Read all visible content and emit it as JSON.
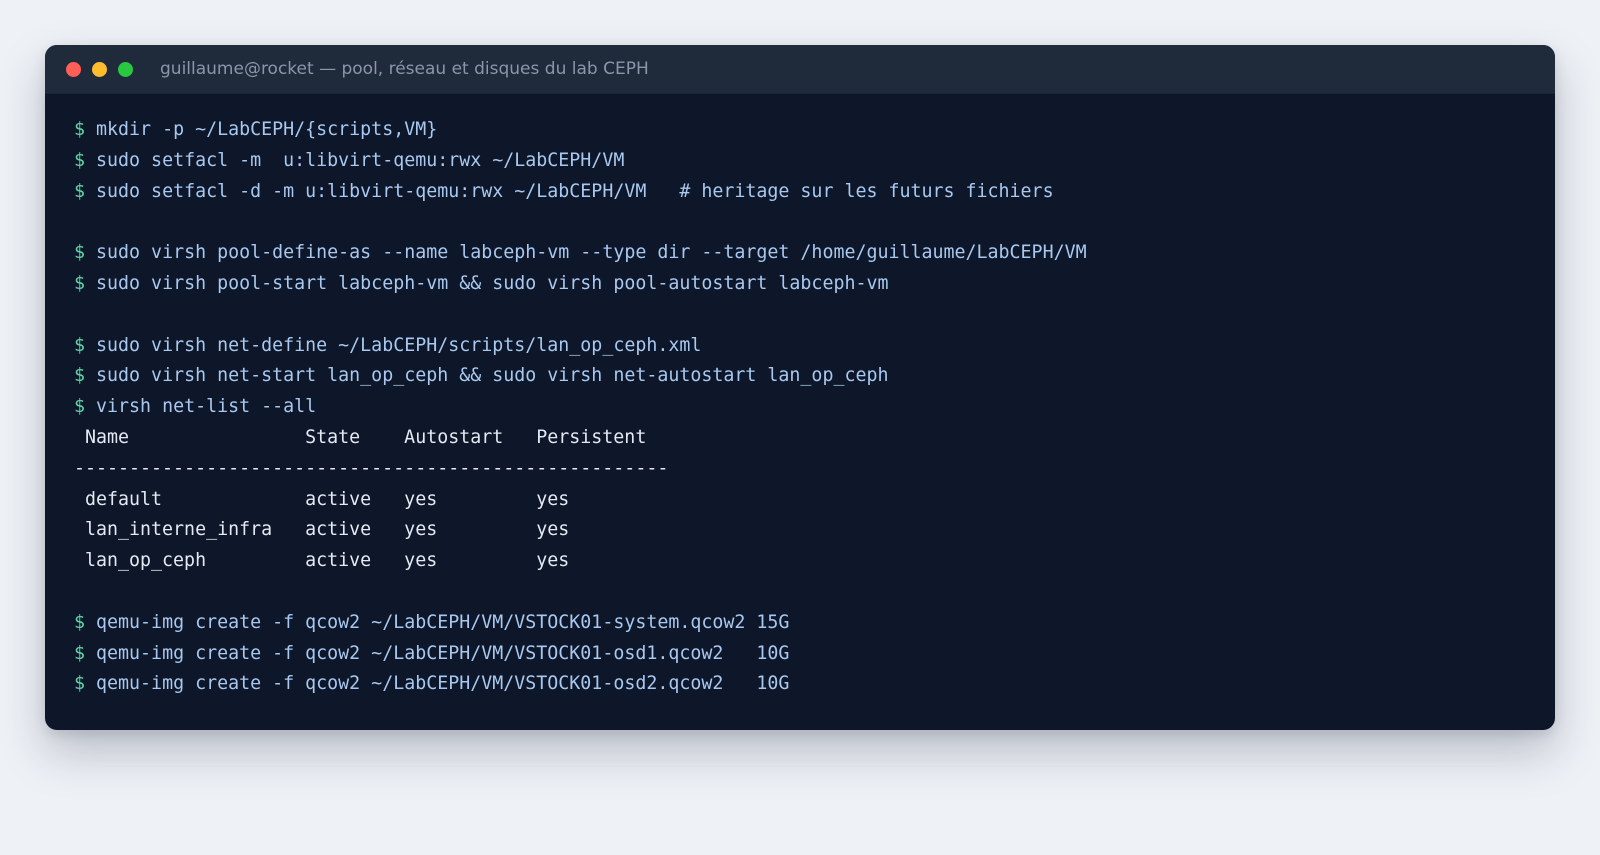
{
  "window": {
    "title": "guillaume@rocket — pool, réseau et disques du lab CEPH",
    "controls": {
      "close_color": "#ff5f57",
      "minimize_color": "#febc2e",
      "zoom_color": "#28c840"
    }
  },
  "terminal": {
    "prompt_symbol": "$",
    "lines": [
      {
        "kind": "cmd",
        "text": "mkdir -p ~/LabCEPH/{scripts,VM}"
      },
      {
        "kind": "cmd",
        "text": "sudo setfacl -m  u:libvirt-qemu:rwx ~/LabCEPH/VM"
      },
      {
        "kind": "cmd",
        "text": "sudo setfacl -d -m u:libvirt-qemu:rwx ~/LabCEPH/VM   # heritage sur les futurs fichiers"
      },
      {
        "kind": "blank",
        "text": ""
      },
      {
        "kind": "cmd",
        "text": "sudo virsh pool-define-as --name labceph-vm --type dir --target /home/guillaume/LabCEPH/VM"
      },
      {
        "kind": "cmd",
        "text": "sudo virsh pool-start labceph-vm && sudo virsh pool-autostart labceph-vm"
      },
      {
        "kind": "blank",
        "text": ""
      },
      {
        "kind": "cmd",
        "text": "sudo virsh net-define ~/LabCEPH/scripts/lan_op_ceph.xml"
      },
      {
        "kind": "cmd",
        "text": "sudo virsh net-start lan_op_ceph && sudo virsh net-autostart lan_op_ceph"
      },
      {
        "kind": "cmd",
        "text": "virsh net-list --all"
      },
      {
        "kind": "out",
        "text": " Name                State    Autostart   Persistent"
      },
      {
        "kind": "out",
        "text": "------------------------------------------------------"
      },
      {
        "kind": "out",
        "text": " default             active   yes         yes"
      },
      {
        "kind": "out",
        "text": " lan_interne_infra   active   yes         yes"
      },
      {
        "kind": "out",
        "text": " lan_op_ceph         active   yes         yes"
      },
      {
        "kind": "blank",
        "text": ""
      },
      {
        "kind": "cmd",
        "text": "qemu-img create -f qcow2 ~/LabCEPH/VM/VSTOCK01-system.qcow2 15G"
      },
      {
        "kind": "cmd",
        "text": "qemu-img create -f qcow2 ~/LabCEPH/VM/VSTOCK01-osd1.qcow2   10G"
      },
      {
        "kind": "cmd",
        "text": "qemu-img create -f qcow2 ~/LabCEPH/VM/VSTOCK01-osd2.qcow2   10G"
      }
    ]
  }
}
